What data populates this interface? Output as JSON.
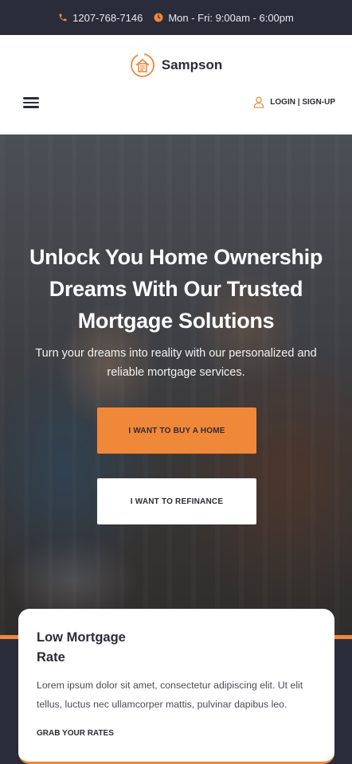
{
  "topbar": {
    "phone": "1207-768-7146",
    "hours": "Mon - Fri: 9:00am - 6:00pm",
    "phone_icon": "phone-icon",
    "clock_icon": "clock-icon"
  },
  "header": {
    "logo_text": "Sampson",
    "logo_icon": "house-document-logo-icon",
    "menu_icon": "hamburger-menu-icon",
    "login_label": "LOGIN | SIGN-UP",
    "user_icon": "user-icon"
  },
  "hero": {
    "title": "Unlock You Home Ownership Dreams With Our Trusted Mortgage Solutions",
    "subtitle": "Turn your dreams into reality with our personalized and reliable mortgage services.",
    "buy_button": "I WANT TO BUY A HOME",
    "refinance_button": "I WANT TO REFINANCE"
  },
  "card": {
    "title": "Low Mortgage Rate",
    "text": "Lorem ipsum dolor sit amet, consectetur adipiscing elit. Ut elit tellus, luctus nec ullamcorper mattis, pulvinar dapibus leo.",
    "link": "GRAB YOUR RATES"
  },
  "colors": {
    "accent": "#f0883a",
    "dark": "#2b2c3a",
    "white": "#ffffff"
  }
}
